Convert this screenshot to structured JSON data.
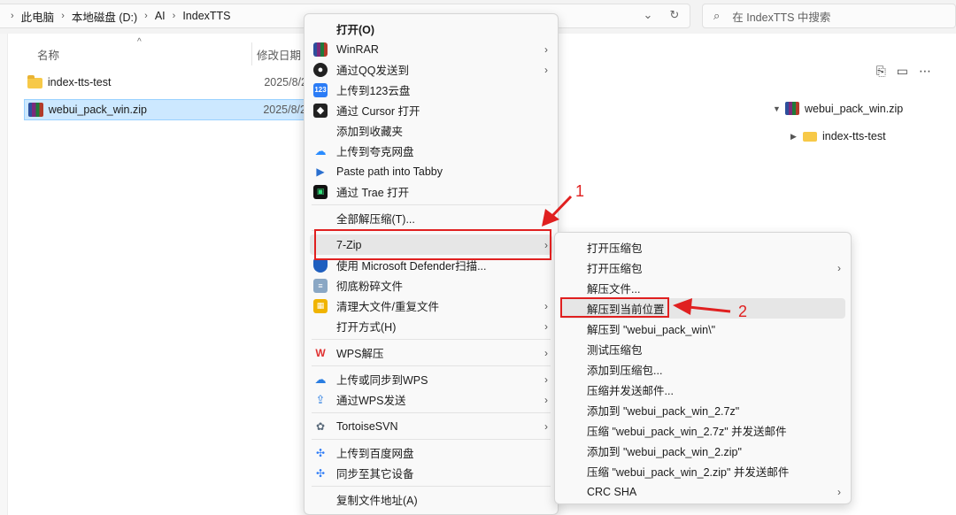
{
  "address_bar": {
    "breadcrumb": [
      "此电脑",
      "本地磁盘 (D:)",
      "AI",
      "IndexTTS"
    ],
    "search_placeholder": "在 IndexTTS 中搜索"
  },
  "file_list": {
    "columns": {
      "name": "名称",
      "modified": "修改日期"
    },
    "rows": [
      {
        "name": "index-tts-test",
        "date": "2025/8/2",
        "type": "folder",
        "selected": false
      },
      {
        "name": "webui_pack_win.zip",
        "date": "2025/8/2",
        "type": "zip",
        "selected": true
      }
    ]
  },
  "detail_pane": {
    "tree": [
      {
        "name": "webui_pack_win.zip",
        "expanded": true
      },
      {
        "name": "index-tts-test",
        "expanded": false
      }
    ]
  },
  "context_menu": {
    "items": [
      {
        "label": "打开(O)",
        "icon": "none",
        "bold": true
      },
      {
        "label": "WinRAR",
        "icon": "winrar-icon",
        "submenu": true
      },
      {
        "label": "通过QQ发送到",
        "icon": "qq-icon",
        "submenu": true
      },
      {
        "label": "上传到123云盘",
        "icon": "cloud123-icon"
      },
      {
        "label": "通过 Cursor 打开",
        "icon": "cursor-icon"
      },
      {
        "label": "添加到收藏夹",
        "icon": "none"
      },
      {
        "label": "上传到夸克网盘",
        "icon": "quark-icon"
      },
      {
        "label": "Paste path into Tabby",
        "icon": "tabby-icon"
      },
      {
        "label": "通过 Trae 打开",
        "icon": "trae-icon"
      },
      {
        "label": "全部解压缩(T)...",
        "icon": "none"
      },
      {
        "label": "7-Zip",
        "icon": "none",
        "submenu": true,
        "highlighted": true
      },
      {
        "label": "使用 Microsoft Defender扫描...",
        "icon": "defender-icon"
      },
      {
        "label": "彻底粉碎文件",
        "icon": "shredder-icon"
      },
      {
        "label": "清理大文件/重复文件",
        "icon": "cleaner-icon",
        "submenu": true
      },
      {
        "label": "打开方式(H)",
        "icon": "none",
        "submenu": true
      },
      {
        "label": "WPS解压",
        "icon": "wps-icon",
        "submenu": true
      },
      {
        "label": "上传或同步到WPS",
        "icon": "wps-cloud-icon",
        "submenu": true
      },
      {
        "label": "通过WPS发送",
        "icon": "wps-send-icon",
        "submenu": true
      },
      {
        "label": "TortoiseSVN",
        "icon": "tortoisesvn-icon",
        "submenu": true
      },
      {
        "label": "上传到百度网盘",
        "icon": "baidu-icon"
      },
      {
        "label": "同步至其它设备",
        "icon": "baidu-sync-icon"
      },
      {
        "label": "复制文件地址(A)",
        "icon": "none"
      }
    ]
  },
  "sevenzip_submenu": {
    "items": [
      {
        "label": "打开压缩包"
      },
      {
        "label": "打开压缩包",
        "submenu": true
      },
      {
        "label": "解压文件..."
      },
      {
        "label": "解压到当前位置",
        "highlighted": true
      },
      {
        "label": "解压到 \"webui_pack_win\\\""
      },
      {
        "label": "测试压缩包"
      },
      {
        "label": "添加到压缩包..."
      },
      {
        "label": "压缩并发送邮件..."
      },
      {
        "label": "添加到 \"webui_pack_win_2.7z\""
      },
      {
        "label": "压缩 \"webui_pack_win_2.7z\" 并发送邮件"
      },
      {
        "label": "添加到 \"webui_pack_win_2.zip\""
      },
      {
        "label": "压缩 \"webui_pack_win_2.zip\" 并发送邮件"
      },
      {
        "label": "CRC SHA",
        "submenu": true
      }
    ]
  },
  "annotations": {
    "step1": "1",
    "step2": "2",
    "color": "#e02020"
  }
}
